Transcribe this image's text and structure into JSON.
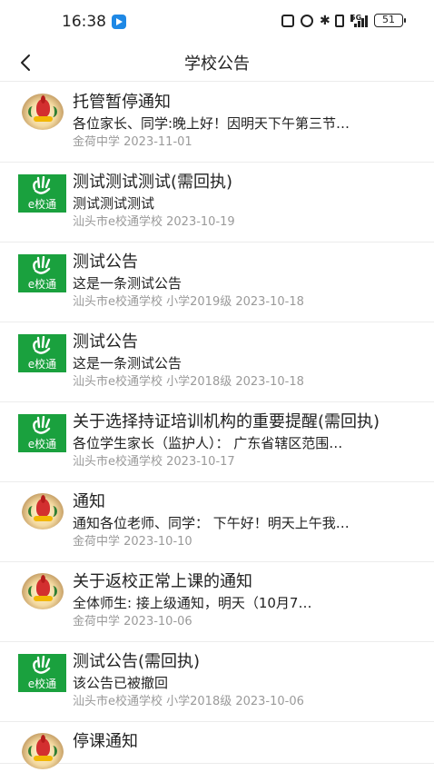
{
  "status_bar": {
    "time": "16:38",
    "network": "5G",
    "battery": "51"
  },
  "header": {
    "title": "学校公告"
  },
  "avatars": {
    "ex_label": "e校通"
  },
  "notices": [
    {
      "title": "托管暂停通知",
      "summary": "各位家长、同学:晚上好！因明天下午第三节…",
      "meta": "金荷中学 2023-11-01",
      "avatar": "school-logo"
    },
    {
      "title": "测试测试测试(需回执)",
      "summary": "测试测试测试",
      "meta": "汕头市e校通学校 2023-10-19",
      "avatar": "ex-logo"
    },
    {
      "title": "测试公告",
      "summary": "这是一条测试公告",
      "meta": "汕头市e校通学校 小学2019级 2023-10-18",
      "avatar": "ex-logo"
    },
    {
      "title": "测试公告",
      "summary": "这是一条测试公告",
      "meta": "汕头市e校通学校 小学2018级 2023-10-18",
      "avatar": "ex-logo"
    },
    {
      "title": "关于选择持证培训机构的重要提醒(需回执)",
      "summary": "各位学生家长（监护人）：  广东省辖区范围…",
      "meta": "汕头市e校通学校 2023-10-17",
      "avatar": "ex-logo"
    },
    {
      "title": "通知",
      "summary": "通知各位老师、同学：  下午好！明天上午我…",
      "meta": "金荷中学 2023-10-10",
      "avatar": "school-logo"
    },
    {
      "title": "关于返校正常上课的通知",
      "summary": "全体师生:          接上级通知，明天（10月7…",
      "meta": "金荷中学 2023-10-06",
      "avatar": "school-logo"
    },
    {
      "title": "测试公告(需回执)",
      "summary": "该公告已被撤回",
      "meta": "汕头市e校通学校 小学2018级 2023-10-06",
      "avatar": "ex-logo"
    },
    {
      "title": "停课通知",
      "summary": "",
      "meta": "",
      "avatar": "school-logo"
    }
  ]
}
